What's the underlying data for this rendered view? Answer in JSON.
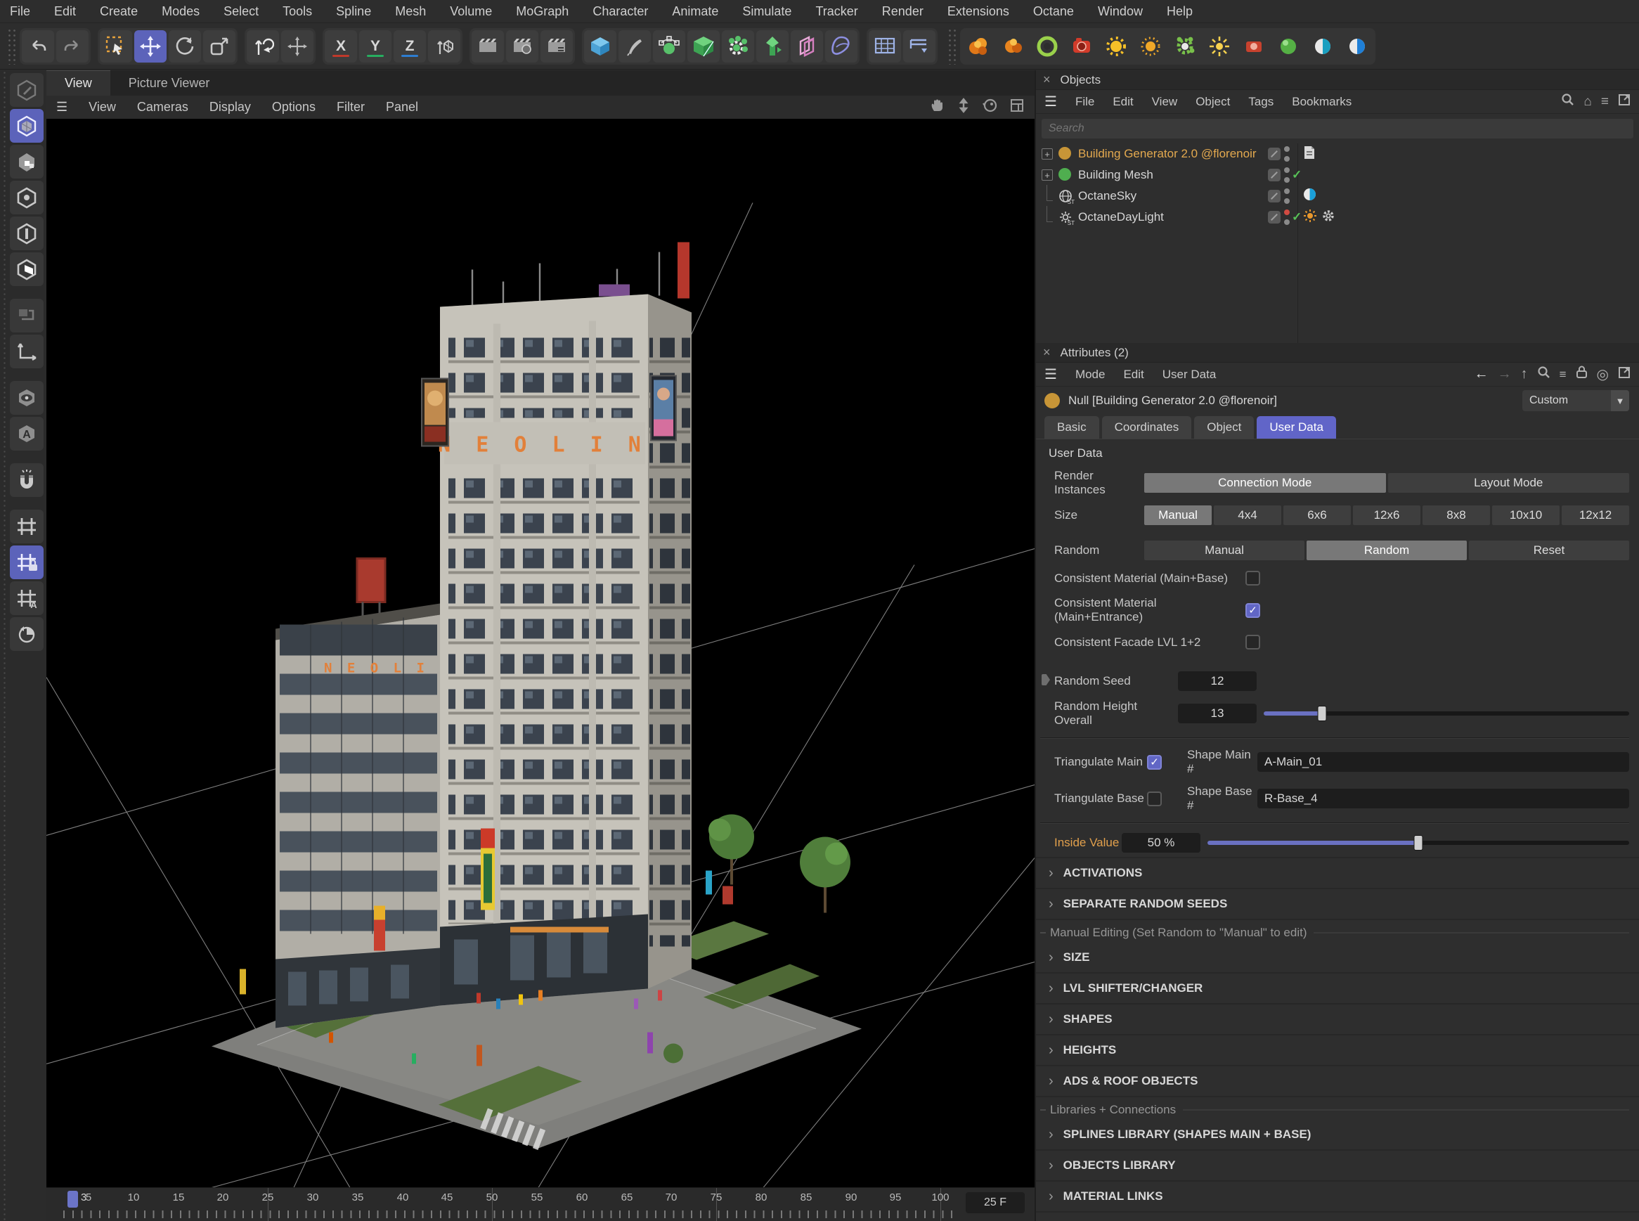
{
  "glyphs": {
    "close": "×",
    "hamburger": "☰",
    "chevron": "›",
    "check": "✓",
    "plus": "+",
    "dropdown": "▼",
    "st_badge": "ST",
    "arrow_left": "←",
    "arrow_right": "→",
    "arrow_up": "↑",
    "home": "⌂",
    "filter": "≡",
    "target": "◎",
    "search": "⌕"
  },
  "menubar": {
    "items": [
      "File",
      "Edit",
      "Create",
      "Modes",
      "Select",
      "Tools",
      "Spline",
      "Mesh",
      "Volume",
      "MoGraph",
      "Character",
      "Animate",
      "Simulate",
      "Tracker",
      "Render",
      "Extensions",
      "Octane",
      "Window",
      "Help"
    ]
  },
  "toolbar": {
    "axis_buttons": [
      "X",
      "Y",
      "Z"
    ]
  },
  "viewport": {
    "tabs": [
      "View",
      "Picture Viewer"
    ],
    "menu": [
      "View",
      "Cameras",
      "Display",
      "Options",
      "Filter",
      "Panel"
    ],
    "tower_sign": "N E O L I N",
    "podium_sign": "N E O L I N"
  },
  "timeline": {
    "current_frame": "3",
    "labels": [
      "5",
      "10",
      "15",
      "20",
      "25",
      "30",
      "35",
      "40",
      "45",
      "50",
      "55",
      "60",
      "65",
      "70",
      "75",
      "80",
      "85",
      "90",
      "95",
      "100"
    ],
    "end_field": "25 F"
  },
  "objects_panel": {
    "title": "Objects",
    "menu": [
      "File",
      "Edit",
      "View",
      "Object",
      "Tags",
      "Bookmarks"
    ],
    "search_placeholder": "Search",
    "rows": [
      {
        "name": "Building Generator 2.0 @florenoir"
      },
      {
        "name": "Building Mesh"
      },
      {
        "name": "OctaneSky"
      },
      {
        "name": "OctaneDayLight"
      }
    ]
  },
  "attributes": {
    "title": "Attributes (2)",
    "menu": [
      "Mode",
      "Edit",
      "User Data"
    ],
    "object_name": "Null [Building Generator 2.0 @florenoir]",
    "preset": "Custom",
    "tabs": [
      "Basic",
      "Coordinates",
      "Object",
      "User Data"
    ],
    "section_title": "User Data",
    "rows": {
      "render_instances": {
        "label": "Render Instances",
        "options": [
          "Connection Mode",
          "Layout Mode"
        ],
        "selected": "Connection Mode"
      },
      "size": {
        "label": "Size",
        "options": [
          "Manual",
          "4x4",
          "6x6",
          "12x6",
          "8x8",
          "10x10",
          "12x12"
        ],
        "selected": "Manual"
      },
      "random": {
        "label": "Random",
        "options": [
          "Manual",
          "Random",
          "Reset"
        ],
        "selected": "Random"
      },
      "cb1": {
        "label": "Consistent Material (Main+Base)",
        "checked": false
      },
      "cb2": {
        "label": "Consistent Material (Main+Entrance)",
        "checked": true
      },
      "cb3": {
        "label": "Consistent Facade LVL 1+2",
        "checked": false
      },
      "random_seed": {
        "label": "Random Seed",
        "value": "12"
      },
      "random_height": {
        "label": "Random Height Overall",
        "value": "13",
        "slider_pct": 16
      },
      "triangulate_main": {
        "label": "Triangulate Main",
        "checked": true
      },
      "shape_main": {
        "label": "Shape Main #",
        "value": "A-Main_01"
      },
      "triangulate_base": {
        "label": "Triangulate Base",
        "checked": false
      },
      "shape_base": {
        "label": "Shape Base #",
        "value": "R-Base_4"
      },
      "inside_value": {
        "label": "Inside Value",
        "value": "50 %",
        "slider_pct": 50
      }
    },
    "groups": {
      "manual_editing": "Manual Editing (Set Random to \"Manual\" to edit)",
      "libraries": "Libraries + Connections"
    },
    "sections_a": [
      "ACTIVATIONS",
      "SEPARATE RANDOM SEEDS"
    ],
    "sections_b": [
      "SIZE",
      "LVL SHIFTER/CHANGER",
      "SHAPES",
      "HEIGHTS",
      "ADS & ROOF OBJECTS"
    ],
    "sections_c": [
      "SPLINES LIBRARY (SHAPES MAIN + BASE)",
      "OBJECTS LIBRARY",
      "MATERIAL LINKS"
    ]
  },
  "colors": {
    "accent": "#5c63ba",
    "orange_text": "#e2a04c",
    "check_green": "#57c157",
    "null_icon": "#c79537",
    "mesh_icon": "#4fae4f",
    "playhead": "#6b74c8"
  }
}
